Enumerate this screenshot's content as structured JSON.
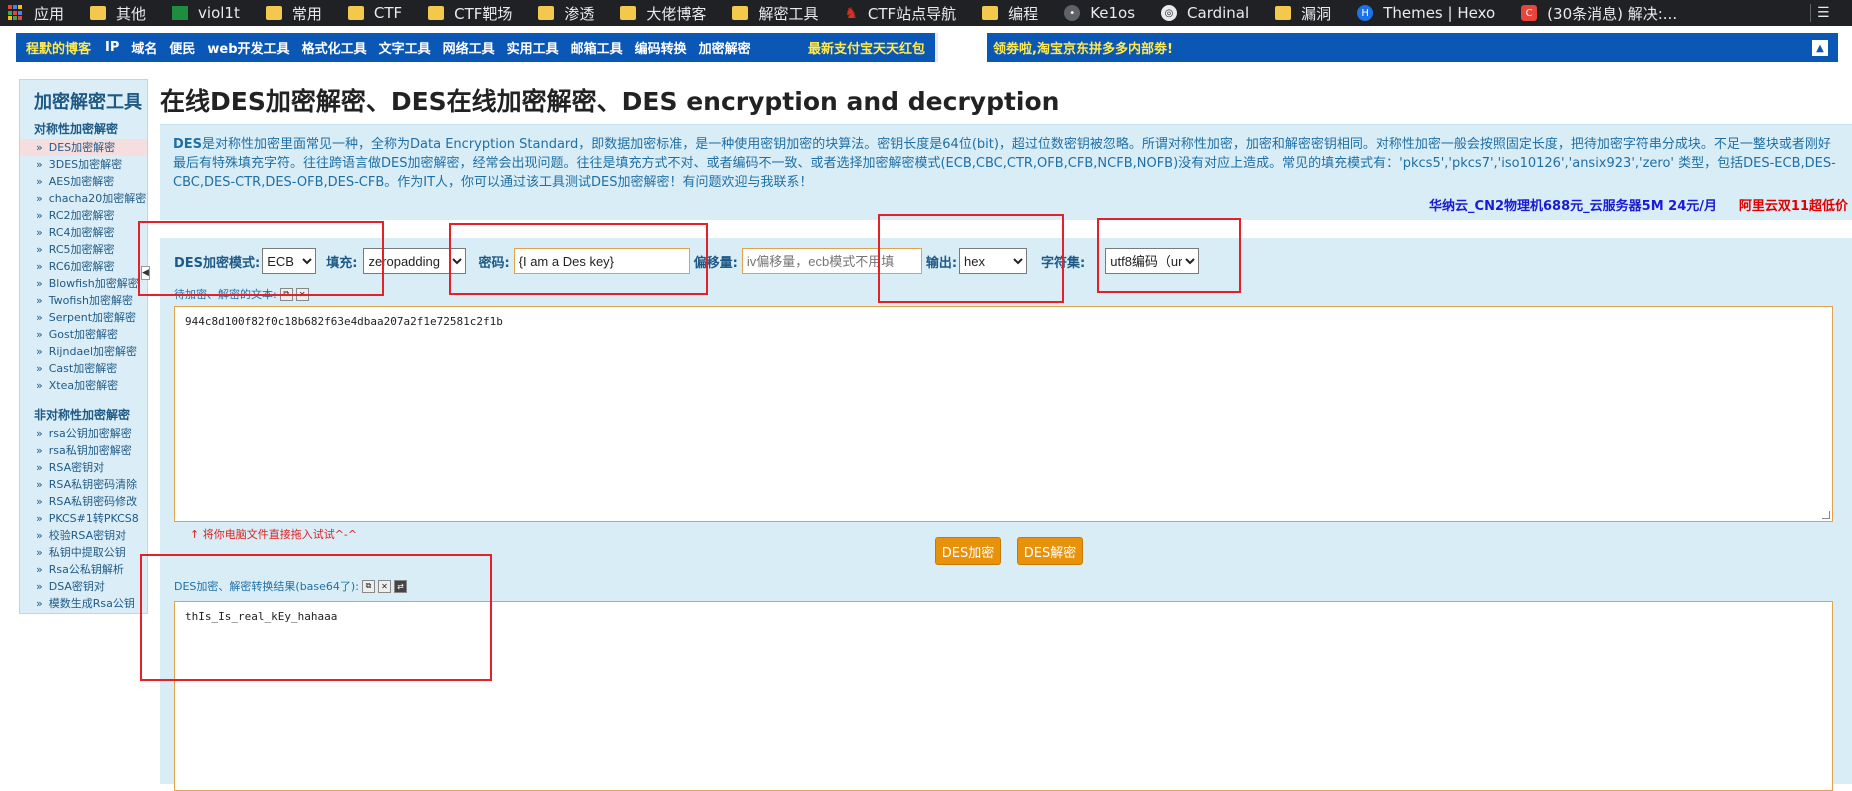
{
  "bookmarks": [
    {
      "label": "应用",
      "icon": "apps-grid-icon"
    },
    {
      "label": "其他",
      "icon": "folder-icon"
    },
    {
      "label": "viol1t",
      "icon": "sheet-icon"
    },
    {
      "label": "常用",
      "icon": "folder-icon"
    },
    {
      "label": "CTF",
      "icon": "folder-icon"
    },
    {
      "label": "CTF靶场",
      "icon": "folder-icon"
    },
    {
      "label": "渗透",
      "icon": "folder-icon"
    },
    {
      "label": "大佬博客",
      "icon": "folder-icon"
    },
    {
      "label": "解密工具",
      "icon": "folder-icon"
    },
    {
      "label": "CTF站点导航",
      "icon": "ctf-site-icon"
    },
    {
      "label": "编程",
      "icon": "folder-icon"
    },
    {
      "label": "Ke1os",
      "icon": "site-icon"
    },
    {
      "label": "Cardinal",
      "icon": "globe-icon"
    },
    {
      "label": "漏洞",
      "icon": "folder-icon"
    },
    {
      "label": "Themes | Hexo",
      "icon": "hexo-icon"
    },
    {
      "label": "(30条消息) 解决:...",
      "icon": "csdn-icon"
    }
  ],
  "topnav": {
    "brand": "程默的博客",
    "items": [
      "IP",
      "域名",
      "便民",
      "web开发工具",
      "格式化工具",
      "文字工具",
      "网络工具",
      "实用工具",
      "邮箱工具",
      "编码转换",
      "加密解密"
    ],
    "promo": "最新支付宝天天红包"
  },
  "adbar": {
    "text": "领劵啦,淘宝京东拼多多内部劵!",
    "up": "▲"
  },
  "sidebar": {
    "title": "加密解密工具",
    "sym_section": "对称性加密解密",
    "sym_items": [
      "DES加密解密",
      "3DES加密解密",
      "AES加密解密",
      "chacha20加密解密",
      "RC2加密解密",
      "RC4加密解密",
      "RC5加密解密",
      "RC6加密解密",
      "Blowfish加密解密",
      "Twofish加密解密",
      "Serpent加密解密",
      "Gost加密解密",
      "Rijndael加密解密",
      "Cast加密解密",
      "Xtea加密解密"
    ],
    "asym_section": "非对称性加密解密",
    "asym_items": [
      "rsa公钥加密解密",
      "rsa私钥加密解密",
      "RSA密钥对",
      "RSA私钥密码清除",
      "RSA私钥密码修改",
      "PKCS#1转PKCS8",
      "校验RSA密钥对",
      "私钥中提取公钥",
      "Rsa公私钥解析",
      "DSA密钥对",
      "模数生成Rsa公钥"
    ]
  },
  "page": {
    "title": "在线DES加密解密、DES在线加密解密、DES encryption and decryption",
    "desc_bold": "DES",
    "desc": "是对称性加密里面常见一种，全称为Data Encryption Standard，即数据加密标准，是一种使用密钥加密的块算法。密钥长度是64位(bit)，超过位数密钥被忽略。所谓对称性加密，加密和解密密钥相同。对称性加密一般会按照固定长度，把待加密字符串分成块。不足一整块或者刚好最后有特殊填充字符。往往跨语言做DES加密解密，经常会出现问题。往往是填充方式不对、或者编码不一致、或者选择加密解密模式(ECB,CBC,CTR,OFB,CFB,NCFB,NOFB)没有对应上造成。常见的填充模式有：'pkcs5','pkcs7','iso10126','ansix923','zero' 类型，包括DES-ECB,DES-CBC,DES-CTR,DES-OFB,DES-CFB。作为IT人，你可以通过该工具测试DES加密解密！有问题欢迎与我联系！",
    "ad_blue": "华纳云_CN2物理机688元_云服务器5M 24元/月",
    "ad_red": "阿里云双11超低价"
  },
  "form": {
    "mode_label": "DES加密模式:",
    "mode_value": "ECB",
    "padding_label": "填充:",
    "padding_value": "zeropadding",
    "key_label": "密码:",
    "key_value": "{I am a Des key}",
    "iv_label": "偏移量:",
    "iv_placeholder": "iv偏移量，ecb模式不用填",
    "output_label": "输出:",
    "output_value": "hex",
    "charset_label": "字符集:",
    "charset_value": "utf8编码（ur",
    "input_label": "待加密、解密的文本:",
    "input_text": "944c8d100f82f0c18b682f63e4dbaa207a2f1e72581c2f1b",
    "drop_hint": "↑ 将你电脑文件直接拖入试试^-^",
    "encrypt_btn": "DES加密",
    "decrypt_btn": "DES解密",
    "result_label": "DES加密、解密转换结果(base64了):",
    "result_text": "thIs_Is_real_kEy_hahaaa"
  },
  "colors": {
    "nav_bg": "#0b57b5",
    "panel_bg": "#d9edf7",
    "accent_orange": "#e8920c",
    "annotation_red": "#e4202a"
  }
}
